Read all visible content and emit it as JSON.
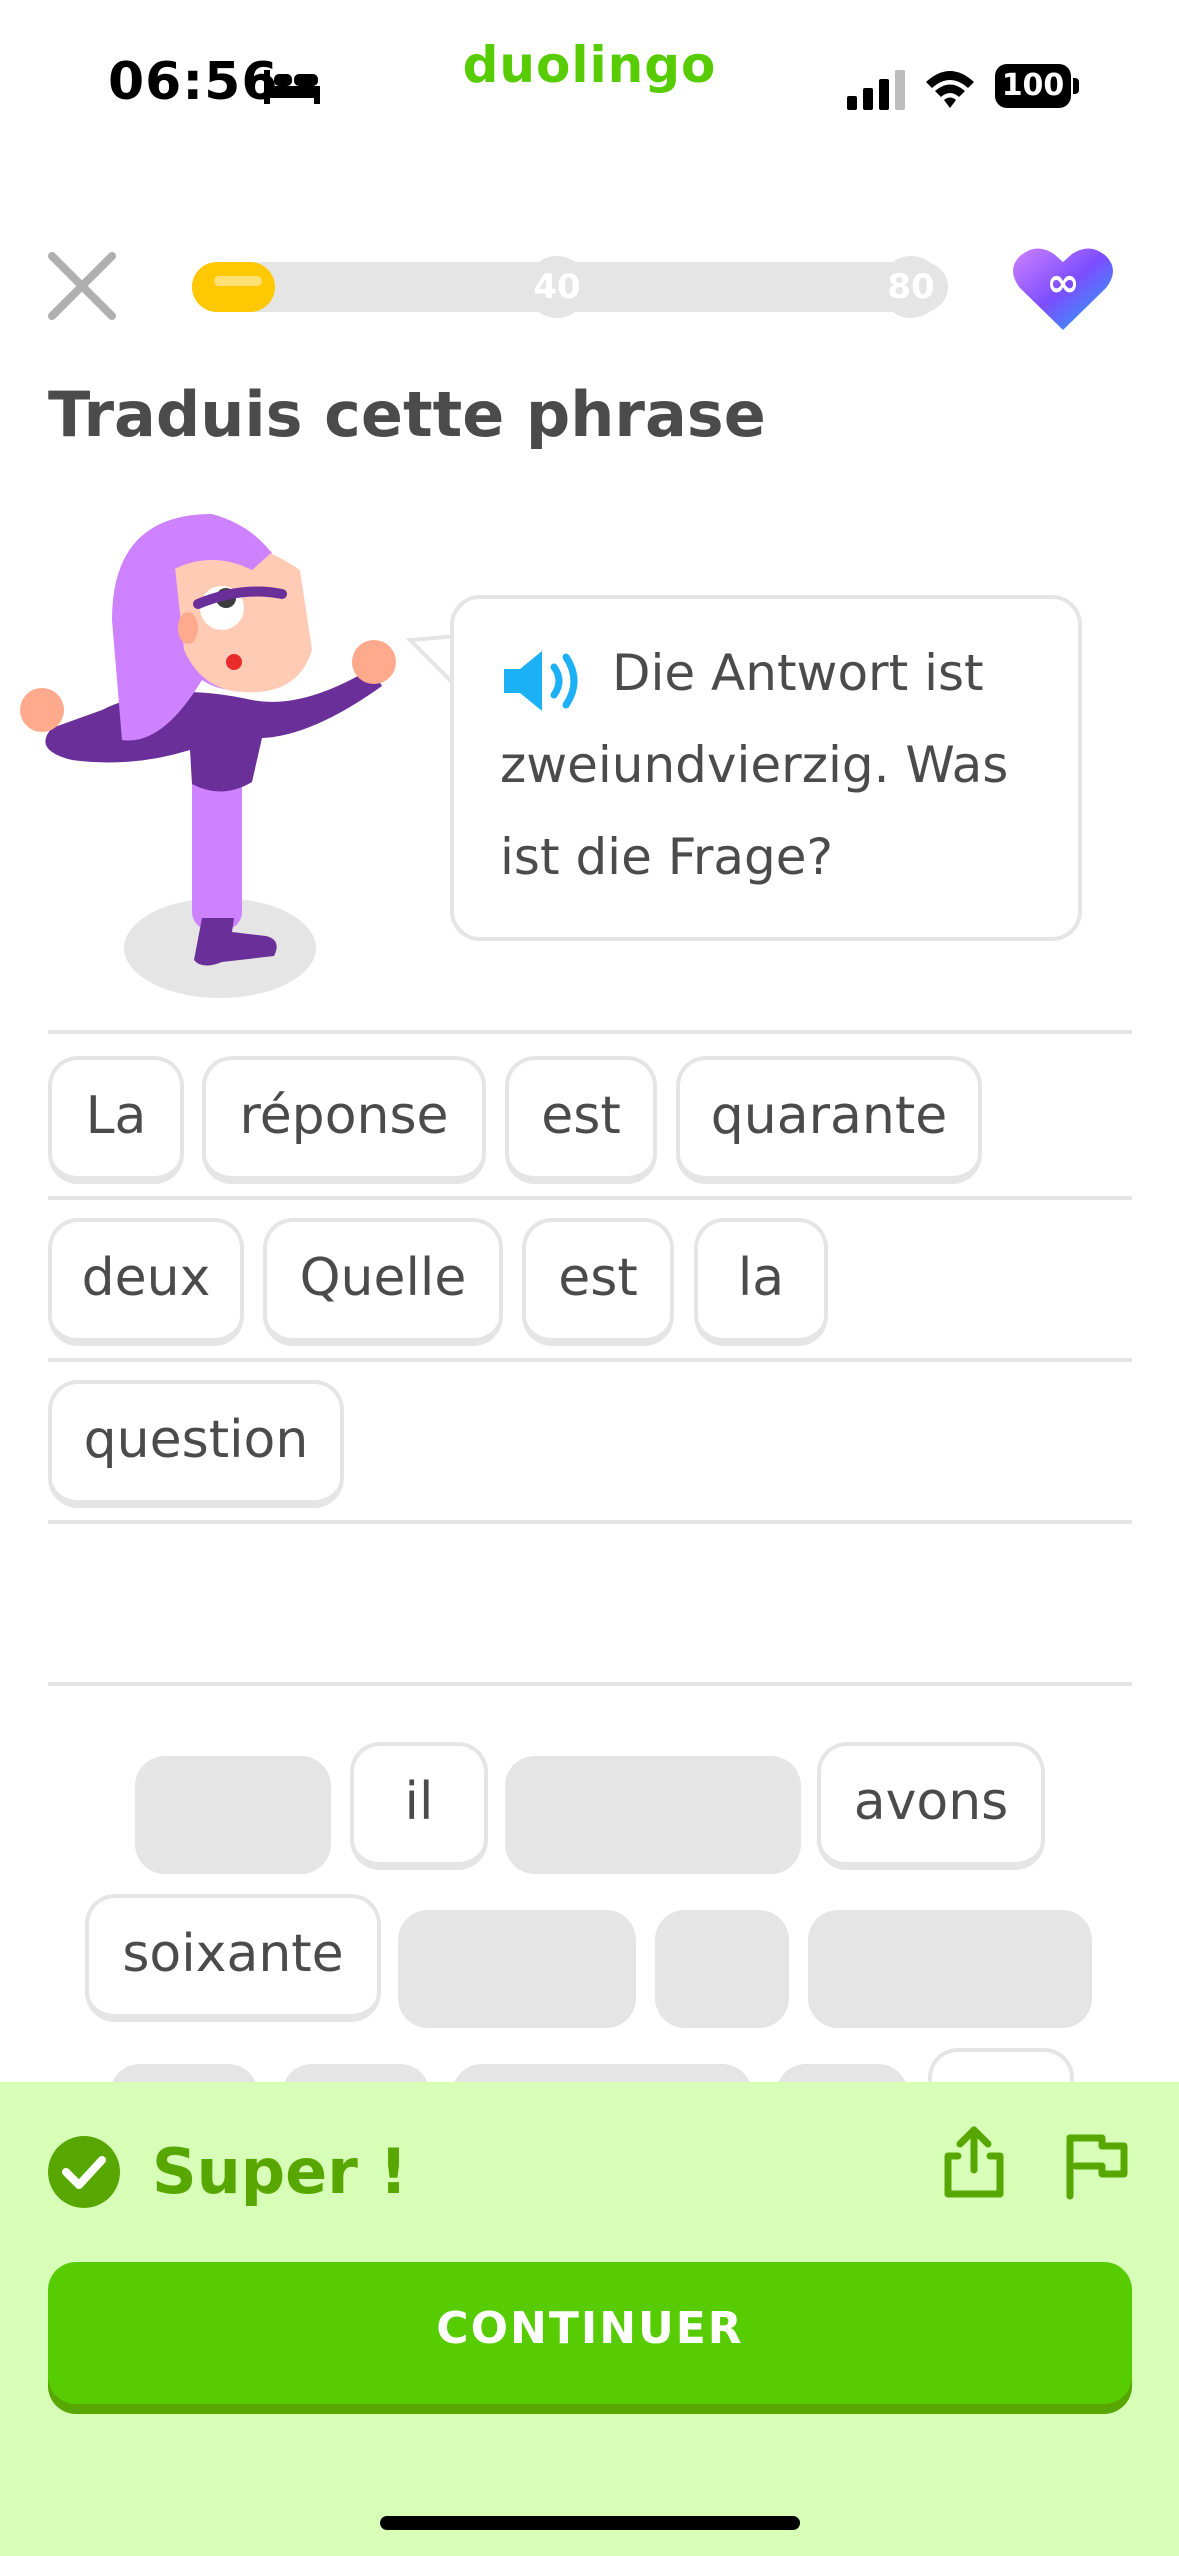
{
  "status_bar": {
    "time": "06:56",
    "brand": "duolingo",
    "battery": "100",
    "icons": [
      "bed-icon",
      "signal-icon",
      "wifi-icon",
      "battery-icon"
    ]
  },
  "header": {
    "progress_fraction": 0.11,
    "milestones": [
      "40",
      "80"
    ],
    "hearts": "∞",
    "colors": {
      "progress": "#ffc800",
      "track": "#e5e5e5"
    }
  },
  "prompt": {
    "title": "Traduis cette phrase",
    "sentence": "Die Antwort ist zweiundvierzig. Was ist die Frage?"
  },
  "answer_words": [
    "La",
    "réponse",
    "est",
    "quarante",
    "deux",
    "Quelle",
    "est",
    "la",
    "question"
  ],
  "word_bank_visible": [
    "il",
    "avons",
    "soixante"
  ],
  "feedback": {
    "title": "Super !",
    "button": "CONTINUER",
    "colors": {
      "panel": "#d7ffb8",
      "accent": "#58cc02",
      "text": "#58a700"
    }
  }
}
